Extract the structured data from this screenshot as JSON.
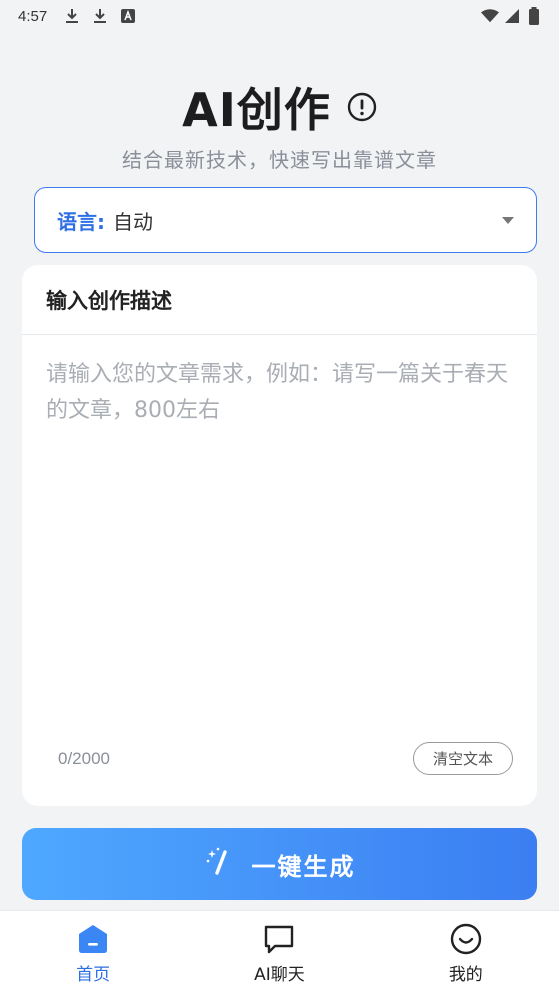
{
  "status_bar": {
    "time": "4:57",
    "left_icons": [
      "download-icon",
      "download-icon",
      "text-a-icon"
    ],
    "right_icons": [
      "wifi-icon",
      "signal-icon",
      "battery-icon"
    ]
  },
  "header": {
    "title": "AI创作",
    "subtitle": "结合最新技术，快速写出靠谱文章"
  },
  "language": {
    "label": "语言:",
    "value": "自动"
  },
  "editor": {
    "title": "输入创作描述",
    "value": "",
    "placeholder": "请输入您的文章需求，例如：请写一篇关于春天的文章，800左右",
    "counter": "0/2000",
    "clear_label": "清空文本"
  },
  "generate": {
    "label": "一键生成"
  },
  "bottom_nav": [
    {
      "label": "首页",
      "icon": "home-icon",
      "active": true
    },
    {
      "label": "AI聊天",
      "icon": "chat-icon",
      "active": false
    },
    {
      "label": "我的",
      "icon": "smile-icon",
      "active": false
    }
  ],
  "colors": {
    "accent": "#2f6fe4",
    "gradient_start": "#4fa8ff",
    "gradient_end": "#3b7ef2",
    "background": "#f2f3f5"
  }
}
